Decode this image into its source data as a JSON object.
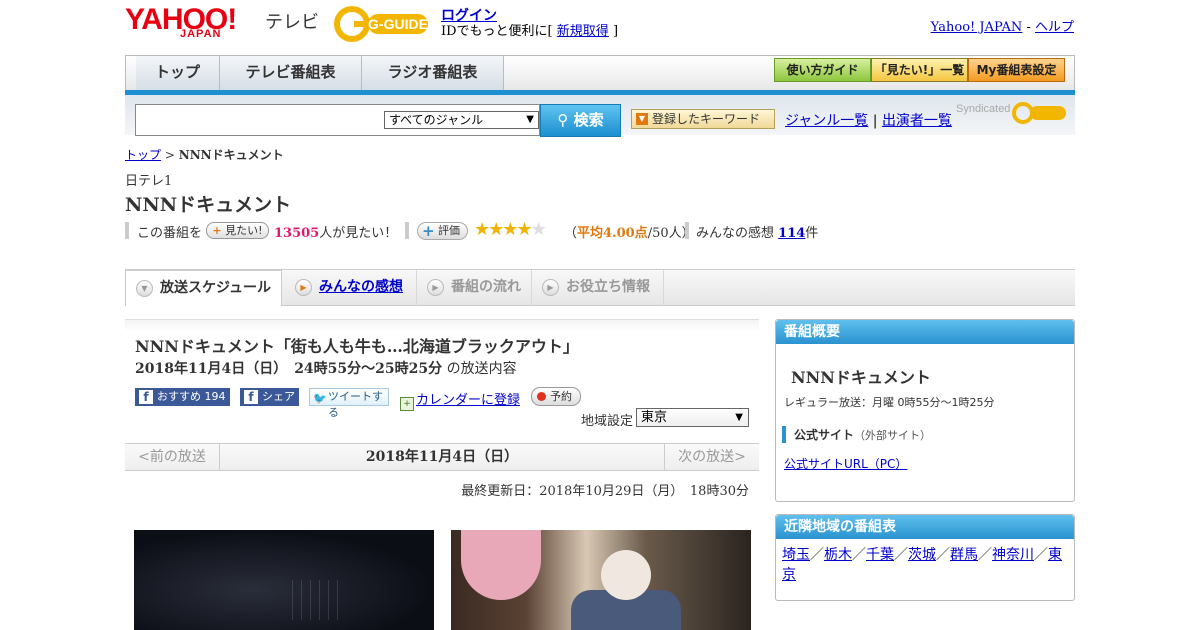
{
  "header": {
    "logo_yahoo": "YAHOO!",
    "logo_japan": "JAPAN",
    "logo_tv": "テレビ",
    "logo_gguide": "G-GUIDE",
    "login": "ログイン",
    "login_sub_prefix": "IDでもっと便利に[",
    "register": "新規取得",
    "login_sub_suffix": "]",
    "yahoo_japan": "Yahoo! JAPAN",
    "sep": "-",
    "help": "ヘルプ"
  },
  "nav": {
    "tabs": [
      "トップ",
      "テレビ番組表",
      "ラジオ番組表"
    ],
    "buttons": [
      "使い方ガイド",
      "「見たい!」一覧",
      "My番組表設定"
    ]
  },
  "search": {
    "placeholder": "",
    "genre": "すべてのジャンル",
    "button": "検索",
    "keyword_btn": "登録したキーワード",
    "genre_list": "ジャンル一覧",
    "divider": "|",
    "cast_list": "出演者一覧",
    "syndicated": "Syndicated"
  },
  "breadcrumb": {
    "top": "トップ",
    "sep": ">",
    "current": "NNNドキュメント"
  },
  "program": {
    "channel": "日テレ1",
    "title": "NNNドキュメント",
    "mitai_prefix": "この番組を",
    "mitai_btn": "見たい!",
    "mitai_count": "13505",
    "mitai_suffix": "人が見たい！",
    "eval_btn": "評価",
    "rating": 4,
    "rating_max": 5,
    "avg_prefix": "（",
    "avg_value": "平均4.00点",
    "avg_suffix": "/50人）",
    "kanso_prefix": "みんなの感想",
    "kanso_count": "114",
    "kanso_suffix": "件"
  },
  "tabs": [
    "放送スケジュール",
    "みんなの感想",
    "番組の流れ",
    "お役立ち情報"
  ],
  "episode": {
    "title": "NNNドキュメント「街も人も牛も…北海道ブラックアウト」",
    "date_time": "2018年11月4日（日）　24時55分～25時25分",
    "date_suffix": "の放送内容",
    "fb_recommend": "おすすめ",
    "fb_count": "194",
    "fb_share": "シェア",
    "tweet": "ツイートする",
    "calendar": "カレンダーに登録",
    "reserve": "予約",
    "region_label": "地域設定",
    "region": "東京",
    "prev": "<前の放送",
    "date": "2018年11月4日（日）",
    "next": "次の放送>",
    "updated": "最終更新日：2018年10月29日（月）　18時30分"
  },
  "overview": {
    "heading": "番組概要",
    "title": "NNNドキュメント",
    "regular": "レギュラー放送：月曜 0時55分～1時25分",
    "official": "公式サイト",
    "official_note": "（外部サイト）",
    "url": "公式サイトURL（PC）"
  },
  "nearby": {
    "heading": "近隣地域の番組表",
    "regions": [
      "埼玉",
      "栃木",
      "千葉",
      "茨城",
      "群馬",
      "神奈川",
      "東京"
    ],
    "sep": "／"
  },
  "colors": {
    "accent_blue": "#1e8fd0",
    "yahoo_red": "#e60012",
    "pink_count": "#e2186f",
    "star": "#f0b400"
  }
}
